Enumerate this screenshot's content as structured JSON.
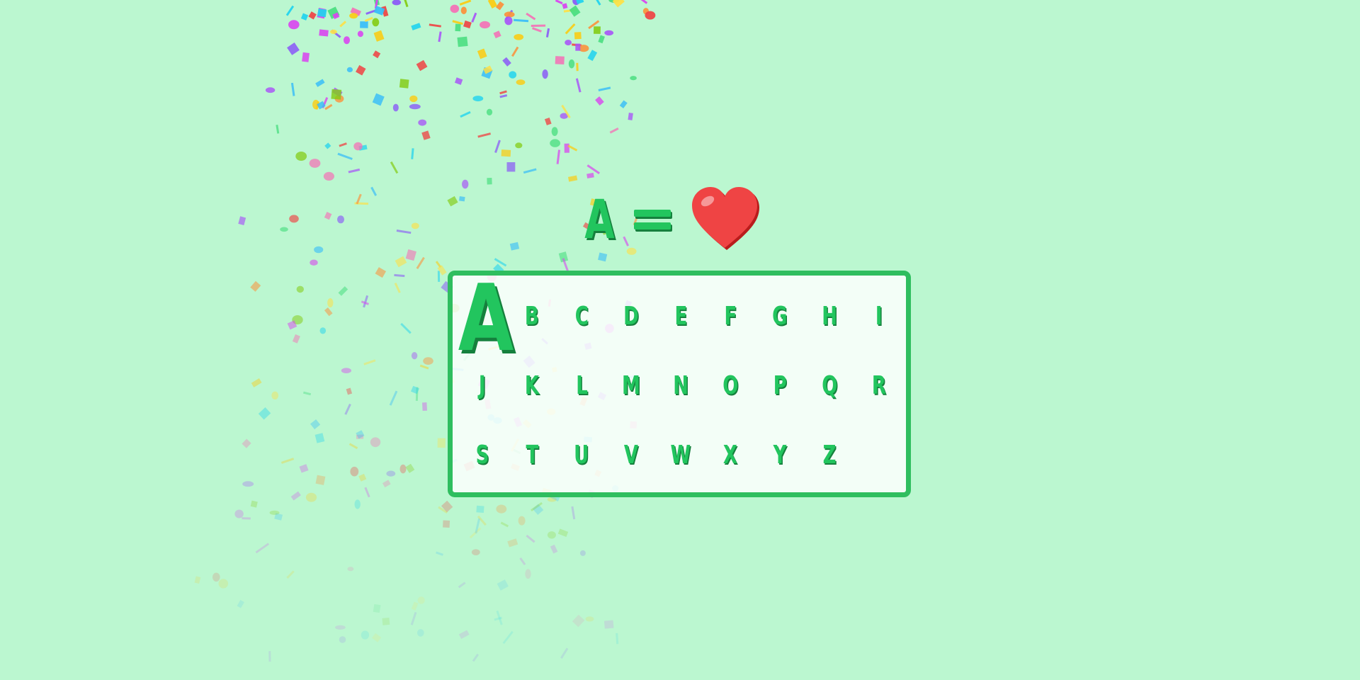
{
  "equation": {
    "letter": "A",
    "equals": "=",
    "picture": "heart-icon",
    "heart_color": "#ef4444"
  },
  "colors": {
    "background": "#bbf7d0",
    "letter": "#22c55e",
    "letter_shadow": "#15803d",
    "board_border": "#2fbe5f"
  },
  "alphabet": {
    "active": "A",
    "rows": [
      [
        "A",
        "B",
        "C",
        "D",
        "E",
        "F",
        "G",
        "H",
        "I"
      ],
      [
        "J",
        "K",
        "L",
        "M",
        "N",
        "O",
        "P",
        "Q",
        "R"
      ],
      [
        "S",
        "T",
        "U",
        "V",
        "W",
        "X",
        "Y",
        "Z"
      ]
    ]
  }
}
